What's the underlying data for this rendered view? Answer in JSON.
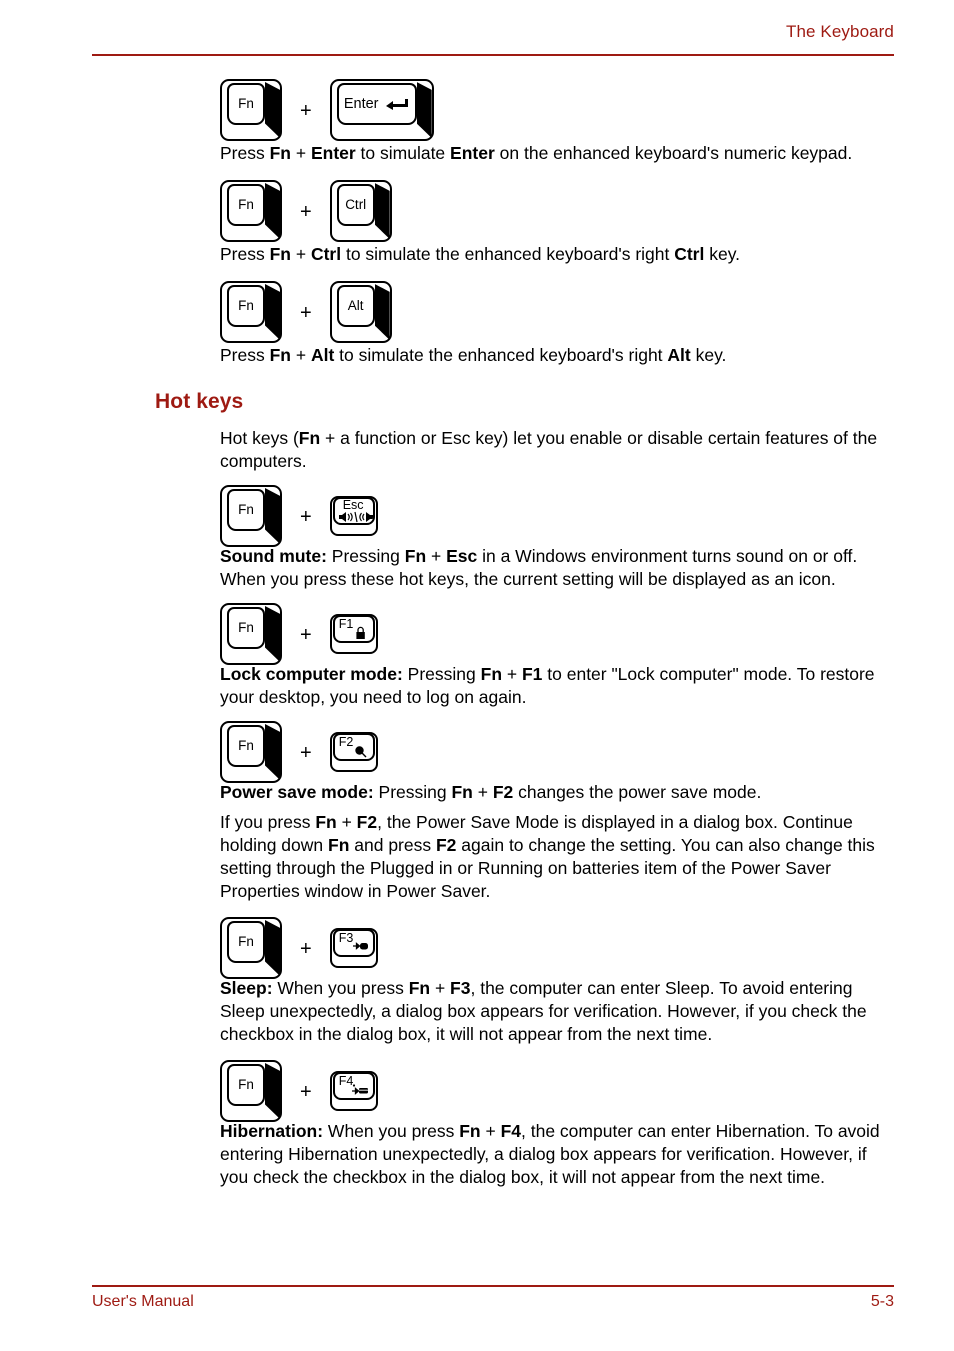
{
  "header": {
    "title": "The Keyboard"
  },
  "footer": {
    "left": "User's Manual",
    "right": "5-3"
  },
  "colors": {
    "accent": "#9e1a12",
    "text": "#000000",
    "page": "#ffffff"
  },
  "sections": {
    "hot_keys_heading": "Hot keys",
    "hot_keys_intro_1": "Hot keys (",
    "hot_keys_intro_fn": "Fn",
    "hot_keys_intro_2": " + a function or Esc key) let you enable or disable certain features of the computers."
  },
  "keys": {
    "fn": "Fn",
    "enter": "Enter",
    "ctrl": "Ctrl",
    "alt": "Alt",
    "esc": "Esc",
    "f1": "F1",
    "f2": "F2",
    "f3": "F3",
    "f4": "F4",
    "plus": "+"
  },
  "icons": {
    "enter_arrow": "enter-arrow-icon",
    "sound_mute": "sound-mute-icon",
    "lock": "padlock-icon",
    "power_save": "power-save-icon",
    "sleep": "sleep-icon",
    "hibernation": "hibernation-icon"
  },
  "paragraphs": {
    "enter": {
      "p1": "Press ",
      "b1": "Fn",
      "p2": " + ",
      "b2": "Enter",
      "p3": " to simulate ",
      "b3": "Enter",
      "p4": " on the enhanced keyboard's numeric keypad."
    },
    "ctrl": {
      "p1": "Press ",
      "b1": "Fn",
      "p2": " + ",
      "b2": "Ctrl",
      "p3": " to simulate the enhanced keyboard's right ",
      "b3": "Ctrl",
      "p4": " key."
    },
    "alt": {
      "p1": "Press ",
      "b1": "Fn",
      "p2": " + ",
      "b2": "Alt",
      "p3": " to simulate the enhanced keyboard's right ",
      "b3": "Alt",
      "p4": " key."
    },
    "sound_mute": {
      "b0": "Sound mute:",
      "p1": " Pressing ",
      "b1": "Fn",
      "p2": " + ",
      "b2": "Esc",
      "p3": " in a Windows environment turns sound on or off. When you press these hot keys, the current setting will be displayed as an icon."
    },
    "lock_computer": {
      "b0": "Lock computer mode:",
      "p1": " Pressing ",
      "b1": "Fn",
      "p2": " + ",
      "b2": "F1",
      "p3": " to enter \"Lock computer\" mode. To restore your desktop, you need to log on again."
    },
    "power_save": {
      "b0": "Power save mode:",
      "p1": " Pressing ",
      "b1": "Fn",
      "p2": " + ",
      "b2": "F2",
      "p3": " changes the power save mode."
    },
    "power_save_detail": {
      "p1": "If you press ",
      "b1": "Fn",
      "p2": " + ",
      "b2": "F2",
      "p3": ", the Power Save Mode is displayed in a dialog box. Continue holding down ",
      "b3": "Fn",
      "p4": " and press ",
      "b4": "F2",
      "p5": " again to change the setting. You can also change this setting through the Plugged in or Running on batteries item of the Power Saver Properties window in Power Saver."
    },
    "sleep": {
      "b0": "Sleep:",
      "p1": " When you press ",
      "b1": "Fn",
      "p2": " + ",
      "b2": "F3",
      "p3": ", the computer can enter Sleep. To avoid entering Sleep unexpectedly, a dialog box appears for verification. However, if you check the checkbox in the dialog box, it will not appear from the next time."
    },
    "hibernation": {
      "b0": "Hibernation:",
      "p1": " When you press ",
      "b1": "Fn",
      "p2": " + ",
      "b2": "F4",
      "p3": ", the computer can enter Hibernation. To avoid entering Hibernation unexpectedly, a dialog box appears for verification. However, if you check the checkbox in the dialog box, it will not appear from the next time."
    }
  }
}
